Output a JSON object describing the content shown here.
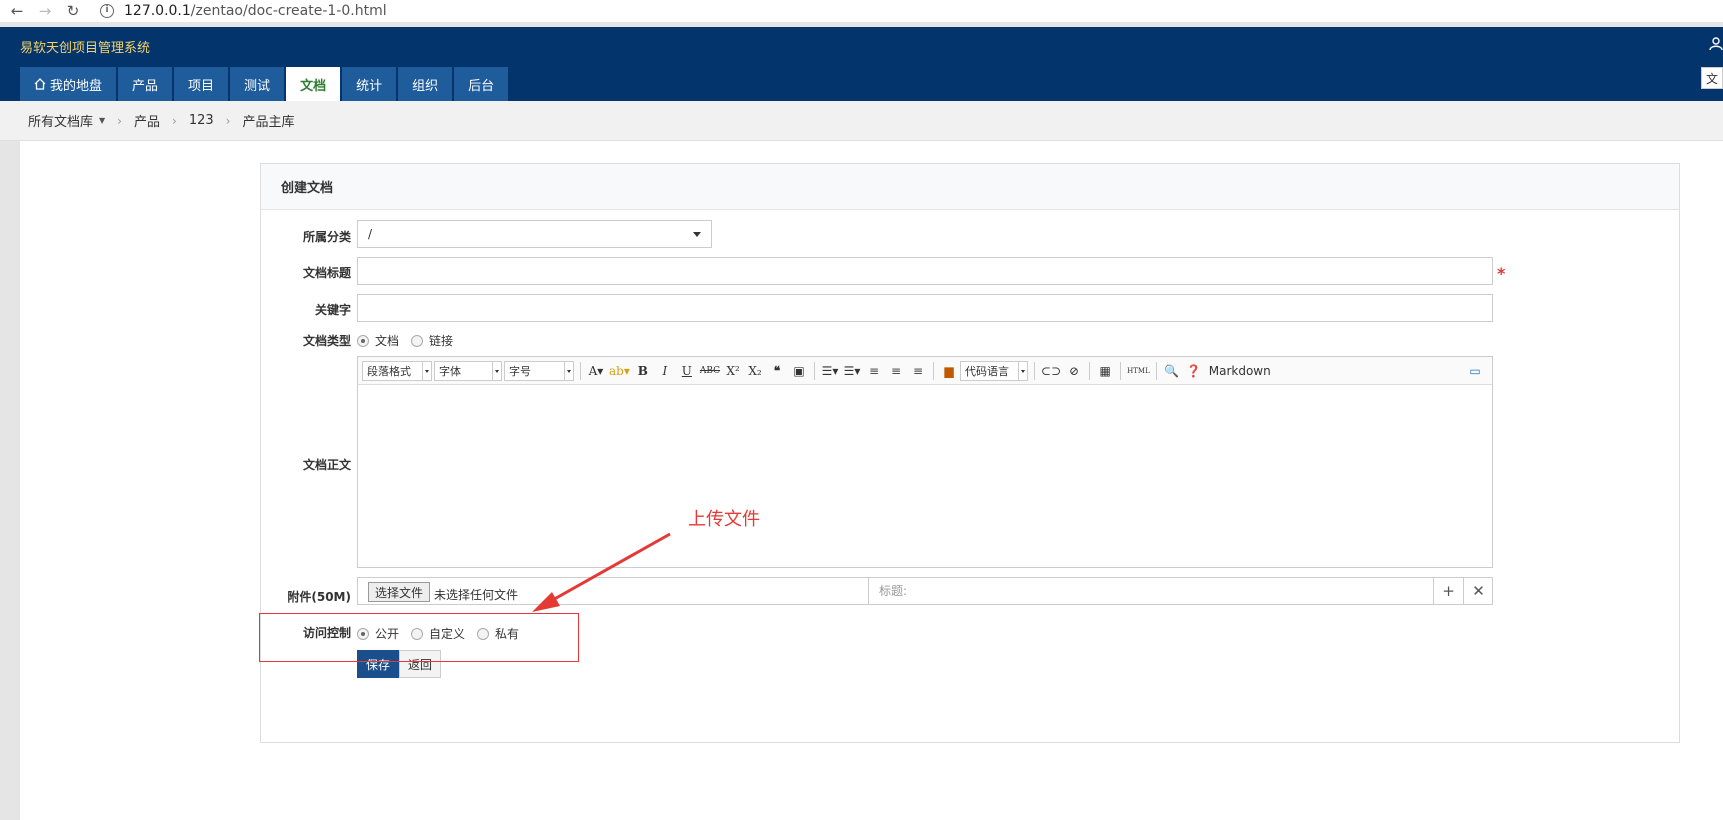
{
  "browser": {
    "back": "←",
    "forward": "→",
    "reload": "↻",
    "url_host": "127.0.0.1",
    "url_path": "/zentao/doc-create-1-0.html"
  },
  "app": {
    "title": "易软天创项目管理系统",
    "user_label": "文"
  },
  "nav": {
    "items": [
      {
        "label": "我的地盘",
        "active": false
      },
      {
        "label": "产品",
        "active": false
      },
      {
        "label": "项目",
        "active": false
      },
      {
        "label": "测试",
        "active": false
      },
      {
        "label": "文档",
        "active": true
      },
      {
        "label": "统计",
        "active": false
      },
      {
        "label": "组织",
        "active": false
      },
      {
        "label": "后台",
        "active": false
      }
    ]
  },
  "breadcrumb": {
    "root": "所有文档库",
    "items": [
      "产品",
      "123",
      "产品主库"
    ]
  },
  "form": {
    "title": "创建文档",
    "category_label": "所属分类",
    "category_value": "/",
    "doc_title_label": "文档标题",
    "doc_title_value": "",
    "keywords_label": "关键字",
    "keywords_value": "",
    "type_label": "文档类型",
    "type_options": [
      "文档",
      "链接"
    ],
    "body_label": "文档正文",
    "editor": {
      "paragraph": "段落格式",
      "font": "字体",
      "size": "字号",
      "code_lang": "代码语言",
      "markdown": "Markdown"
    },
    "attachment_label": "附件(50M)",
    "file_button": "选择文件",
    "file_none": "未选择任何文件",
    "file_title_placeholder": "标题:",
    "access_label": "访问控制",
    "access_options": [
      "公开",
      "自定义",
      "私有"
    ],
    "save": "保存",
    "back": "返回"
  },
  "annotation": {
    "text": "上传文件",
    "color": "#e53935"
  },
  "colors": {
    "header": "#03346b",
    "nav_item": "#1f5c9c",
    "active_nav_text": "#2e7d32",
    "title_text": "#f5d36a",
    "primary_button": "#1a4f8b"
  }
}
